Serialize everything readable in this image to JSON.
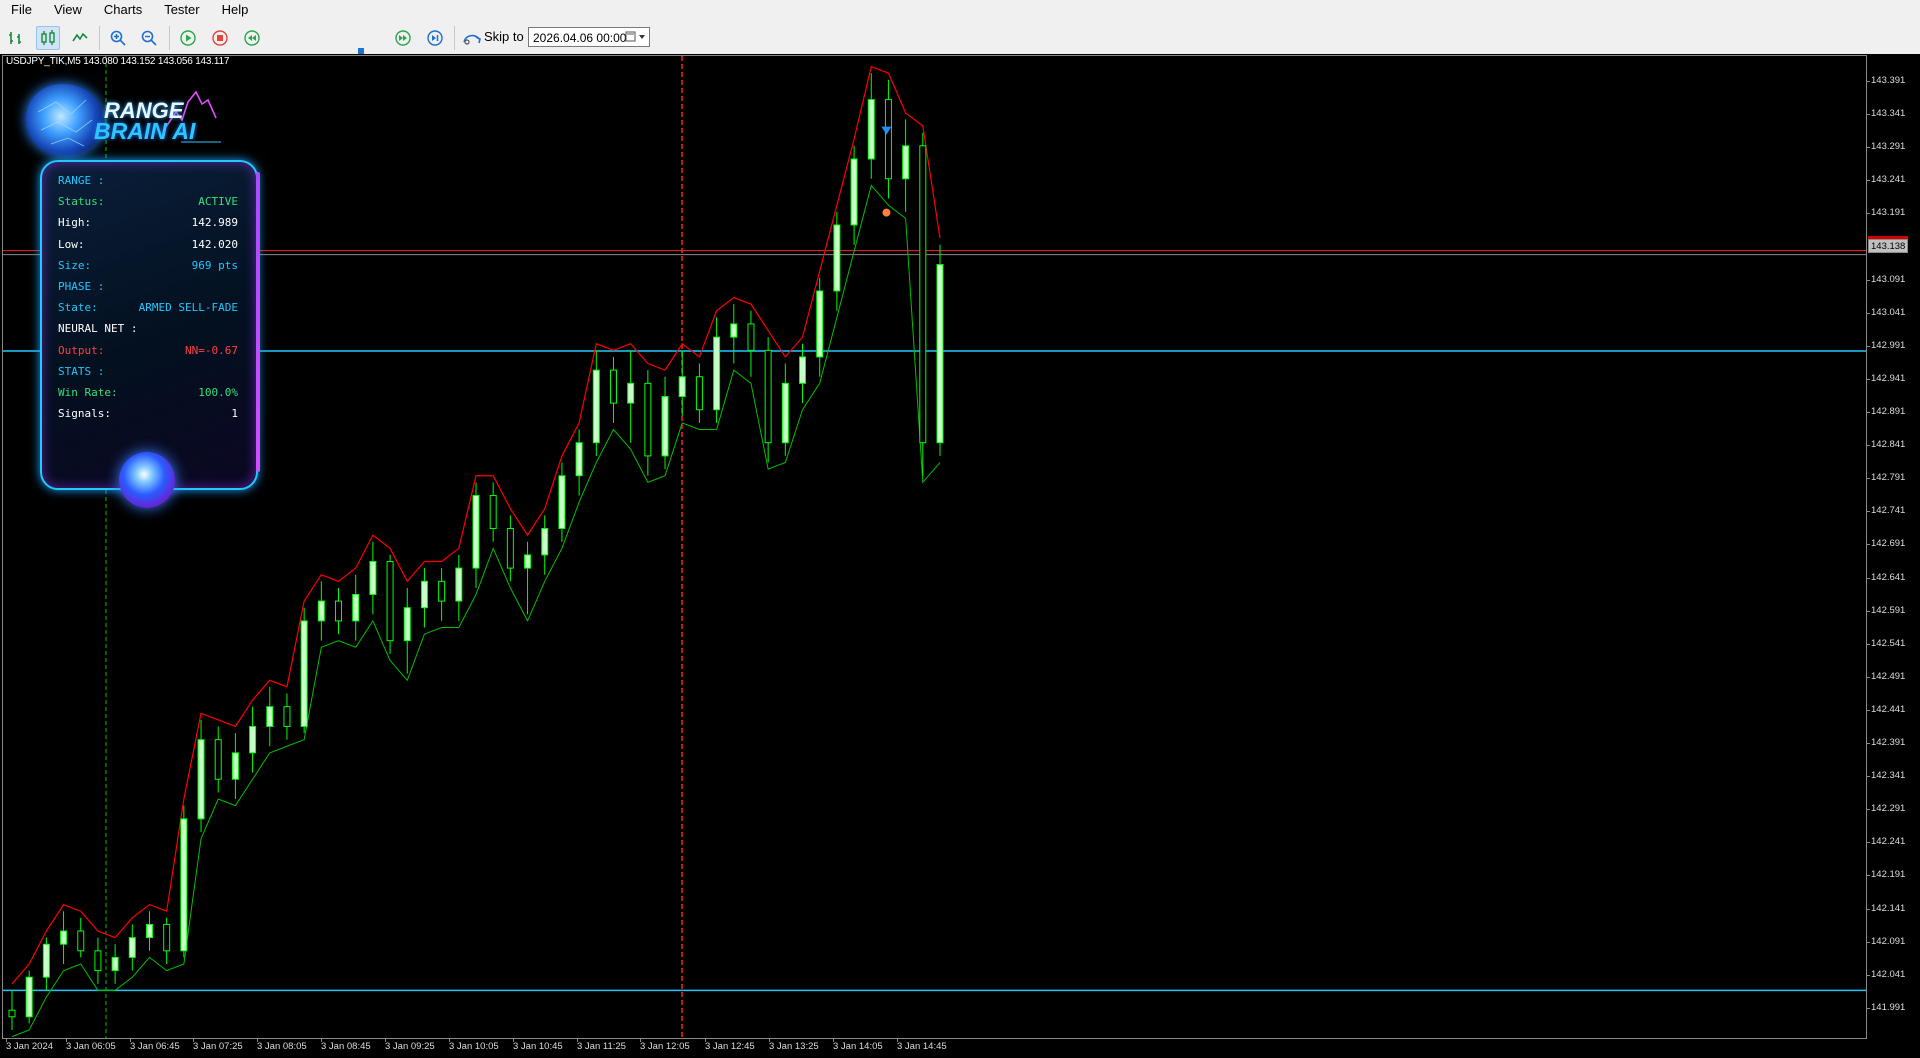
{
  "menu": [
    "File",
    "View",
    "Charts",
    "Tester",
    "Help"
  ],
  "toolbar": {
    "skip_label": "Skip to",
    "skip_date": "2026.04.06 00:00",
    "icons": [
      "bar-chart-icon",
      "candlestick-icon",
      "line-chart-icon",
      "zoom-in-icon",
      "zoom-out-icon",
      "play-icon",
      "stop-icon",
      "rewind-icon",
      "fast-forward-icon",
      "step-forward-icon",
      "skip-to-icon"
    ],
    "speed_fraction": 0.8
  },
  "chart": {
    "symbol_info": "USDJPY_TIK,M5  143.080 143.152 143.056 143.117",
    "price_ticks": [
      "143.391",
      "143.341",
      "143.291",
      "143.241",
      "143.191",
      "143.091",
      "143.041",
      "142.991",
      "142.941",
      "142.891",
      "142.841",
      "142.791",
      "142.741",
      "142.691",
      "142.641",
      "142.591",
      "142.541",
      "142.491",
      "142.441",
      "142.391",
      "142.341",
      "142.291",
      "142.241",
      "142.191",
      "142.141",
      "142.091",
      "142.041",
      "141.991"
    ],
    "current_price": "143.138",
    "time_labels": [
      "3 Jan 2024",
      "3 Jan 06:05",
      "3 Jan 06:45",
      "3 Jan 07:25",
      "3 Jan 08:05",
      "3 Jan 08:45",
      "3 Jan 09:25",
      "3 Jan 10:05",
      "3 Jan 10:45",
      "3 Jan 11:25",
      "3 Jan 12:05",
      "3 Jan 12:45",
      "3 Jan 13:25",
      "3 Jan 14:05",
      "3 Jan 14:45"
    ],
    "colors": {
      "background": "#000000",
      "bull": "#00ff00",
      "bear": "#00ff00",
      "envelope_high": "#ff0000",
      "envelope_low": "#00c000",
      "range_line": "#1ec8ff",
      "high_line": "#ff2020",
      "vline_red": "#ff2020",
      "vline_green": "#00c000"
    }
  },
  "logo": {
    "line1": "RANGE",
    "line2": "BRAIN AI"
  },
  "panel": {
    "rows": [
      {
        "k": "RANGE :",
        "v": "",
        "kc": "#1ec8ff",
        "vc": "#1ec8ff"
      },
      {
        "k": "Status:",
        "v": "ACTIVE",
        "kc": "#33e07a",
        "vc": "#33e07a"
      },
      {
        "k": "High:",
        "v": "142.989",
        "kc": "#ffffff",
        "vc": "#ffffff"
      },
      {
        "k": "Low:",
        "v": "142.020",
        "kc": "#ffffff",
        "vc": "#ffffff"
      },
      {
        "k": "Size:",
        "v": "969 pts",
        "kc": "#1ec8ff",
        "vc": "#1ec8ff"
      },
      {
        "k": "PHASE :",
        "v": "",
        "kc": "#1ec8ff",
        "vc": "#1ec8ff"
      },
      {
        "k": "State:",
        "v": "ARMED SELL-FADE",
        "kc": "#1ec8ff",
        "vc": "#1ec8ff"
      },
      {
        "k": "NEURAL NET :",
        "v": "",
        "kc": "#ffffff",
        "vc": "#ffffff"
      },
      {
        "k": "Output:",
        "v": "NN=-0.67",
        "kc": "#ff4040",
        "vc": "#ff4040"
      },
      {
        "k": "STATS :",
        "v": "",
        "kc": "#1ec8ff",
        "vc": "#1ec8ff"
      },
      {
        "k": "Win Rate:",
        "v": "100.0%",
        "kc": "#33e07a",
        "vc": "#33e07a"
      },
      {
        "k": "Signals:",
        "v": "1",
        "kc": "#ffffff",
        "vc": "#ffffff"
      }
    ]
  },
  "chart_data": {
    "type": "candlestick",
    "ylim": [
      141.96,
      143.43
    ],
    "series": [
      {
        "name": "USDJPY_TIK,M5",
        "values": [
          [
            141.99,
            142.02,
            141.96,
            141.98
          ],
          [
            141.98,
            142.05,
            141.97,
            142.04
          ],
          [
            142.04,
            142.1,
            142.02,
            142.09
          ],
          [
            142.09,
            142.14,
            142.06,
            142.11
          ],
          [
            142.11,
            142.13,
            142.07,
            142.08
          ],
          [
            142.08,
            142.1,
            142.03,
            142.05
          ],
          [
            142.05,
            142.09,
            142.03,
            142.07
          ],
          [
            142.07,
            142.12,
            142.05,
            142.1
          ],
          [
            142.1,
            142.14,
            142.08,
            142.12
          ],
          [
            142.12,
            142.13,
            142.06,
            142.08
          ],
          [
            142.08,
            142.3,
            142.07,
            142.28
          ],
          [
            142.28,
            142.43,
            142.26,
            142.4
          ],
          [
            142.4,
            142.42,
            142.32,
            142.34
          ],
          [
            142.34,
            142.41,
            142.31,
            142.38
          ],
          [
            142.38,
            142.45,
            142.35,
            142.42
          ],
          [
            142.42,
            142.48,
            142.39,
            142.45
          ],
          [
            142.45,
            142.47,
            142.4,
            142.42
          ],
          [
            142.42,
            142.6,
            142.41,
            142.58
          ],
          [
            142.58,
            142.64,
            142.55,
            142.61
          ],
          [
            142.61,
            142.63,
            142.56,
            142.58
          ],
          [
            142.58,
            142.65,
            142.55,
            142.62
          ],
          [
            142.62,
            142.7,
            142.59,
            142.67
          ],
          [
            142.67,
            142.68,
            142.53,
            142.55
          ],
          [
            142.55,
            142.63,
            142.5,
            142.6
          ],
          [
            142.6,
            142.66,
            142.57,
            142.64
          ],
          [
            142.64,
            142.66,
            142.58,
            142.61
          ],
          [
            142.61,
            142.68,
            142.58,
            142.66
          ],
          [
            142.66,
            142.79,
            142.63,
            142.77
          ],
          [
            142.77,
            142.79,
            142.7,
            142.72
          ],
          [
            142.72,
            142.74,
            142.64,
            142.66
          ],
          [
            142.66,
            142.7,
            142.59,
            142.68
          ],
          [
            142.68,
            142.74,
            142.65,
            142.72
          ],
          [
            142.72,
            142.82,
            142.7,
            142.8
          ],
          [
            142.8,
            142.87,
            142.77,
            142.85
          ],
          [
            142.85,
            142.99,
            142.83,
            142.96
          ],
          [
            142.96,
            142.98,
            142.88,
            142.91
          ],
          [
            142.91,
            142.99,
            142.85,
            142.94
          ],
          [
            142.94,
            142.96,
            142.8,
            142.83
          ],
          [
            142.83,
            142.95,
            142.81,
            142.92
          ],
          [
            142.92,
            142.99,
            142.89,
            142.95
          ],
          [
            142.95,
            142.97,
            142.88,
            142.9
          ],
          [
            142.9,
            143.04,
            142.88,
            143.01
          ],
          [
            143.01,
            143.06,
            142.97,
            143.03
          ],
          [
            143.03,
            143.05,
            142.95,
            142.99
          ],
          [
            142.99,
            143.01,
            142.82,
            142.85
          ],
          [
            142.85,
            142.97,
            142.83,
            142.94
          ],
          [
            142.94,
            143.0,
            142.91,
            142.98
          ],
          [
            142.98,
            143.1,
            142.95,
            143.08
          ],
          [
            143.08,
            143.2,
            143.05,
            143.18
          ],
          [
            143.18,
            143.3,
            143.15,
            143.28
          ],
          [
            143.28,
            143.41,
            143.25,
            143.37
          ],
          [
            143.37,
            143.4,
            143.22,
            143.25
          ],
          [
            143.25,
            143.34,
            143.2,
            143.3
          ],
          [
            143.3,
            143.32,
            142.8,
            142.85
          ],
          [
            142.85,
            143.15,
            142.83,
            143.12
          ]
        ]
      }
    ],
    "range_high": 142.989,
    "range_low": 142.02,
    "high_line": 143.138,
    "signals": [
      {
        "type": "sell-arrow",
        "price": 143.32
      }
    ]
  }
}
